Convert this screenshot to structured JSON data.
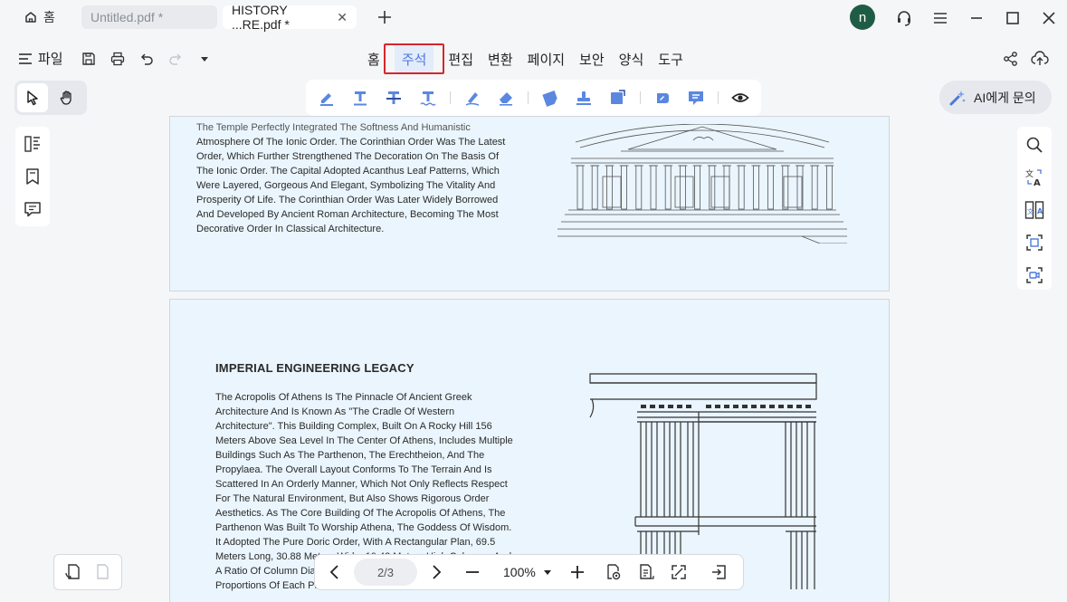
{
  "titlebar": {
    "home_tab": "홈",
    "tabs": [
      {
        "label": "Untitled.pdf *",
        "active": false
      },
      {
        "label": "HISTORY ...RE.pdf *",
        "active": true
      }
    ],
    "avatar_initial": "n"
  },
  "menubar": {
    "file_label": "파일",
    "items": [
      "홈",
      "주석",
      "편집",
      "변환",
      "페이지",
      "보안",
      "양식",
      "도구"
    ],
    "selected": "주석"
  },
  "ai_button": {
    "label": "AI에게 문의"
  },
  "page1": {
    "lines": [
      "The Temple Perfectly Integrated The Softness And Humanistic",
      "Atmosphere Of The Ionic Order. The Corinthian Order Was The Latest",
      "Order, Which Further Strengthened The Decoration On The Basis Of",
      "The Ionic Order. The Capital Adopted Acanthus Leaf Patterns, Which",
      "Were Layered, Gorgeous And Elegant, Symbolizing The Vitality And",
      "Prosperity Of Life. The Corinthian Order Was Later Widely Borrowed",
      "And Developed By Ancient Roman Architecture, Becoming The Most",
      "Decorative Order In Classical Architecture."
    ]
  },
  "page2": {
    "heading": "IMPERIAL ENGINEERING LEGACY",
    "lines": [
      "The Acropolis Of Athens Is The Pinnacle Of Ancient Greek",
      "Architecture And Is Known As \"The Cradle Of Western",
      "Architecture\". This Building Complex, Built On A Rocky Hill 156",
      "Meters Above Sea Level In The Center Of Athens, Includes Multiple",
      "Buildings Such As The Parthenon, The Erechtheion, And The",
      "Propylaea. The Overall Layout Conforms To The Terrain And Is",
      "Scattered In An Orderly Manner, Which Not Only Reflects Respect",
      "For The Natural Environment, But Also Shows Rigorous Order",
      "Aesthetics. As The Core Building Of The Acropolis Of Athens, The",
      "Parthenon Was Built To Worship Athena, The Goddess Of Wisdom.",
      "It Adopted The Pure Doric Order, With A Rectangular Plan, 69.5",
      "Meters Long, 30.88 Meters Wide, 10.43 Meters High Columns, And",
      "A Ratio Of Column Diameter To Column Height Of 1:5.48. The",
      "Proportions Of Each Part"
    ]
  },
  "bottom_nav": {
    "page_indicator": "2/3",
    "zoom": "100%"
  },
  "colors": {
    "accent": "#4c79d9",
    "highlight_border": "#d6262b",
    "page_bg": "#eaf5fd",
    "avatar_bg": "#1f5c46"
  }
}
